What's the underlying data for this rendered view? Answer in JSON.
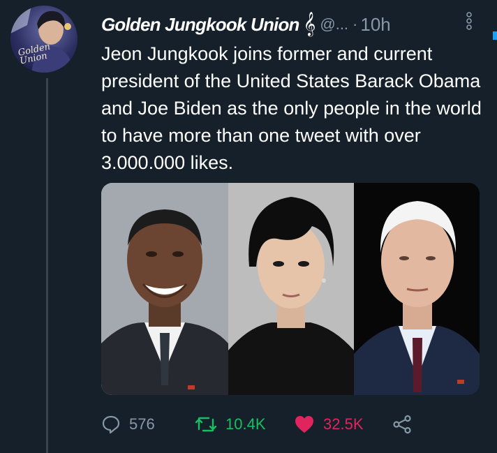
{
  "tweet": {
    "author": {
      "display_name": "Golden Jungkook Union",
      "name_emoji": "𝄞",
      "handle": "@...",
      "avatar_signature": "Golden\nUnion"
    },
    "separator": "·",
    "time": "10h",
    "text": "Jeon Jungkook joins former and current president of the United States Barack Obama and Joe Biden as the only people in the world to have more than one tweet with over 3.000.000 likes.",
    "media": [
      {
        "icon": "portrait-photo"
      },
      {
        "icon": "portrait-photo"
      },
      {
        "icon": "portrait-photo"
      }
    ],
    "actions": {
      "replies": "576",
      "retweets": "10.4K",
      "likes": "32.5K"
    }
  },
  "colors": {
    "background": "#15202b",
    "muted": "#8899a6",
    "retweet": "#17bf63",
    "like": "#e0245e"
  }
}
